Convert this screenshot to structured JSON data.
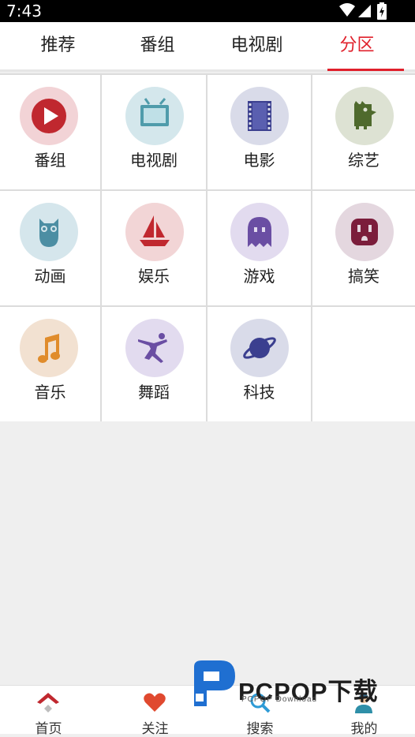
{
  "status_bar": {
    "time": "7:43"
  },
  "tabs": [
    {
      "label": "推荐"
    },
    {
      "label": "番组"
    },
    {
      "label": "电视剧"
    },
    {
      "label": "分区",
      "active": true
    }
  ],
  "categories": [
    {
      "label": "番组",
      "icon": "play-icon",
      "bg": "#f2d3d6",
      "color": "#c0282f"
    },
    {
      "label": "电视剧",
      "icon": "tv-icon",
      "bg": "#d4e7ec",
      "color": "#4f9cab"
    },
    {
      "label": "电影",
      "icon": "film-icon",
      "bg": "#d9dbe9",
      "color": "#3b3f8f"
    },
    {
      "label": "综艺",
      "icon": "monster-icon",
      "bg": "#dde2d3",
      "color": "#4f6a2d"
    },
    {
      "label": "动画",
      "icon": "owl-icon",
      "bg": "#d5e6ec",
      "color": "#4c8ea3"
    },
    {
      "label": "娱乐",
      "icon": "sailboat-icon",
      "bg": "#f2d5d6",
      "color": "#c0282f"
    },
    {
      "label": "游戏",
      "icon": "ghost-icon",
      "bg": "#e2dbef",
      "color": "#6a4ea3"
    },
    {
      "label": "搞笑",
      "icon": "outlet-icon",
      "bg": "#e4d7df",
      "color": "#7b1d3b"
    },
    {
      "label": "音乐",
      "icon": "music-note-icon",
      "bg": "#f2e1d1",
      "color": "#e08c2c"
    },
    {
      "label": "舞蹈",
      "icon": "dancer-icon",
      "bg": "#e2dbef",
      "color": "#6a4ea3"
    },
    {
      "label": "科技",
      "icon": "planet-icon",
      "bg": "#d9dbe9",
      "color": "#3b3f8f"
    }
  ],
  "bottom_nav": [
    {
      "label": "首页",
      "icon": "home-icon"
    },
    {
      "label": "关注",
      "icon": "heart-icon"
    },
    {
      "label": "搜索",
      "icon": "search-icon"
    },
    {
      "label": "我的",
      "icon": "user-icon"
    }
  ],
  "watermark": {
    "text": "PCPOP下载",
    "sub": "PCPOP Download"
  },
  "colors": {
    "accent": "#e0202b"
  }
}
